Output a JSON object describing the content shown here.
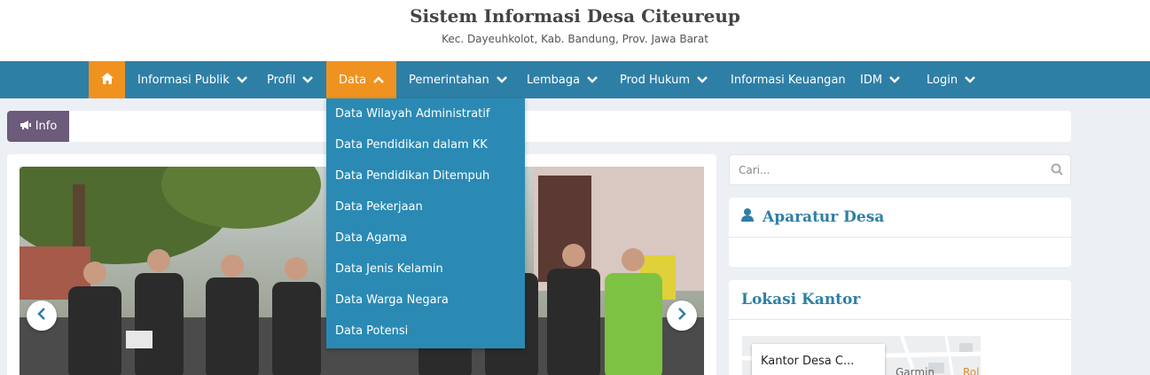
{
  "header": {
    "title": "Sistem Informasi Desa Citeureup",
    "subtitle": "Kec. Dayeuhkolot, Kab. Bandung, Prov. Jawa Barat"
  },
  "nav": {
    "home_icon": "home-icon",
    "items": [
      {
        "label": "Informasi Publik",
        "has_dropdown": true
      },
      {
        "label": "Profil",
        "has_dropdown": true
      },
      {
        "label": "Data",
        "has_dropdown": true,
        "active": true
      },
      {
        "label": "Pemerintahan",
        "has_dropdown": true
      },
      {
        "label": "Lembaga",
        "has_dropdown": true
      },
      {
        "label": "Prod Hukum",
        "has_dropdown": true
      },
      {
        "label": "Informasi Keuangan",
        "has_dropdown": false
      },
      {
        "label": "IDM",
        "has_dropdown": true
      },
      {
        "label": "Login",
        "has_dropdown": true
      }
    ]
  },
  "dropdown": {
    "items": [
      "Data Wilayah Administratif",
      "Data Pendidikan dalam KK",
      "Data Pendidikan Ditempuh",
      "Data Pekerjaan",
      "Data Agama",
      "Data Jenis Kelamin",
      "Data Warga Negara",
      "Data Potensi"
    ]
  },
  "info": {
    "label": "Info",
    "icon": "bullhorn-icon"
  },
  "search": {
    "placeholder": "Cari..."
  },
  "widgets": {
    "aparatur": {
      "title": "Aparatur Desa",
      "icon": "user-icon"
    },
    "lokasi": {
      "title": "Lokasi Kantor"
    }
  },
  "map": {
    "card_title": "Kantor Desa C...",
    "place_label": "Garmin",
    "road_label": "Rol"
  },
  "colors": {
    "nav_bg": "#2e7fa6",
    "accent": "#f0921f",
    "dropdown_bg": "#2a8ab4",
    "info_badge": "#6c5b7b"
  }
}
